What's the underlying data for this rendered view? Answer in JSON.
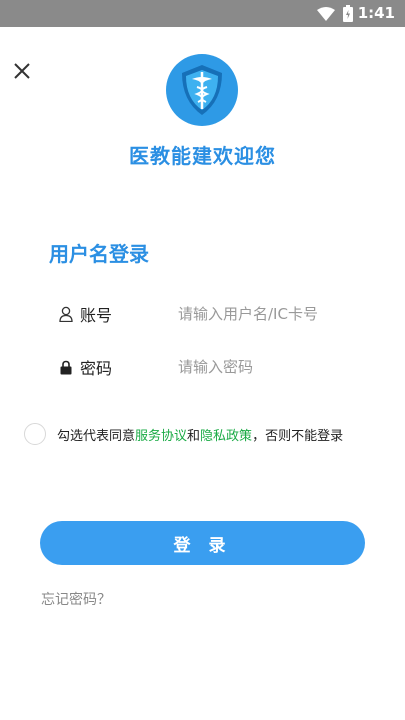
{
  "status_bar": {
    "time": "1:41"
  },
  "app": {
    "title": "医教能建欢迎您"
  },
  "login": {
    "section_title": "用户名登录",
    "account": {
      "label": "账号",
      "placeholder": "请输入用户名/IC卡号",
      "value": ""
    },
    "password": {
      "label": "密码",
      "placeholder": "请输入密码",
      "value": ""
    },
    "agreement": {
      "prefix": "勾选代表同意",
      "service_link": "服务协议",
      "conjunction": "和",
      "privacy_link": "隐私政策",
      "suffix": "，否则不能登录",
      "checked": false
    },
    "submit_label": "登 录",
    "forgot_label": "忘记密码？"
  },
  "colors": {
    "brand": "#2b8fe3",
    "button": "#3a9ef0",
    "link": "#1aab45"
  },
  "icons": [
    "wifi-icon",
    "battery-icon",
    "close-icon",
    "logo-icon",
    "user-icon",
    "lock-icon"
  ]
}
